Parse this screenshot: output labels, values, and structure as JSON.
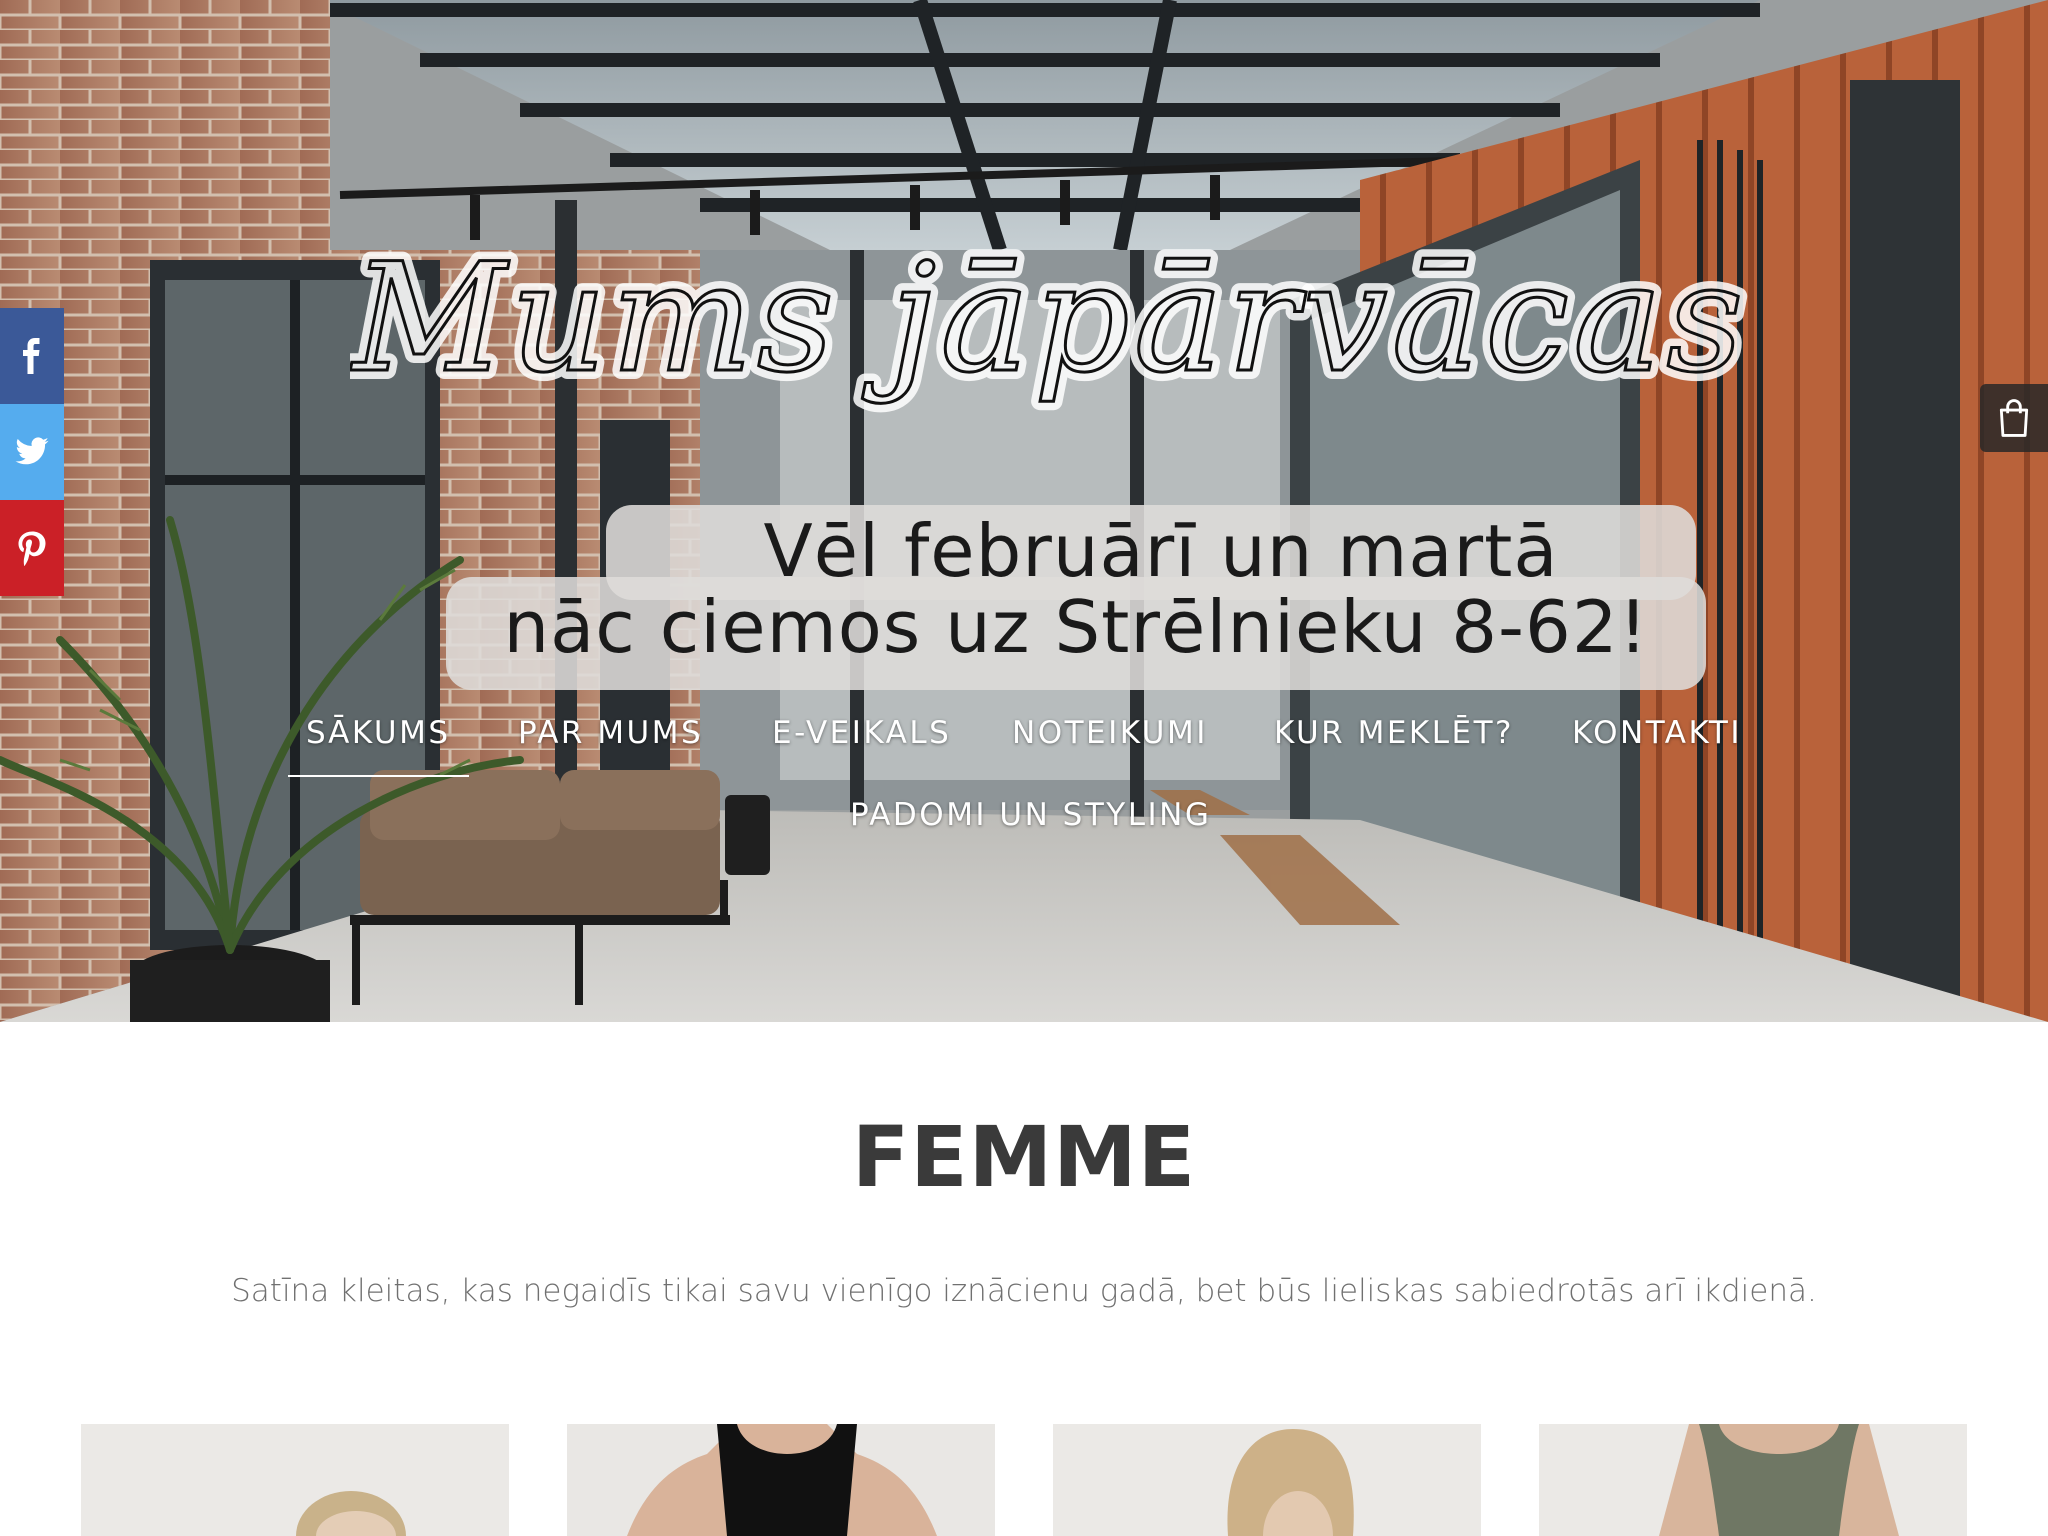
{
  "hero": {
    "script_title": "Mums jāpārvācas",
    "announcement": {
      "line1": "Vēl februārī un martā",
      "line2": "nāc ciemos uz Strēlnieku 8-62!"
    }
  },
  "nav": {
    "items": [
      {
        "label": "SĀKUMS",
        "active": true
      },
      {
        "label": "PAR MUMS"
      },
      {
        "label": "E-VEIKALS"
      },
      {
        "label": "NOTEIKUMI"
      },
      {
        "label": "KUR MEKLĒT?"
      },
      {
        "label": "KONTAKTI"
      },
      {
        "label": "PADOMI UN STYLING"
      }
    ]
  },
  "social": {
    "facebook_icon": "facebook-icon",
    "twitter_icon": "twitter-icon",
    "pinterest_icon": "pinterest-icon",
    "colors": {
      "facebook": "#3b5998",
      "twitter": "#55acee",
      "pinterest": "#cb2027"
    }
  },
  "cart": {
    "icon": "shopping-bag-icon"
  },
  "main": {
    "title": "FEMME",
    "description": "Satīna kleitas, kas negaidīs tikai savu vienīgo iznācienu gadā, bet būs lieliskas sabiedrotās arī ikdienā."
  },
  "products": [
    {
      "image": "product-image-1"
    },
    {
      "image": "product-image-2"
    },
    {
      "image": "product-image-3"
    },
    {
      "image": "product-image-4"
    }
  ]
}
